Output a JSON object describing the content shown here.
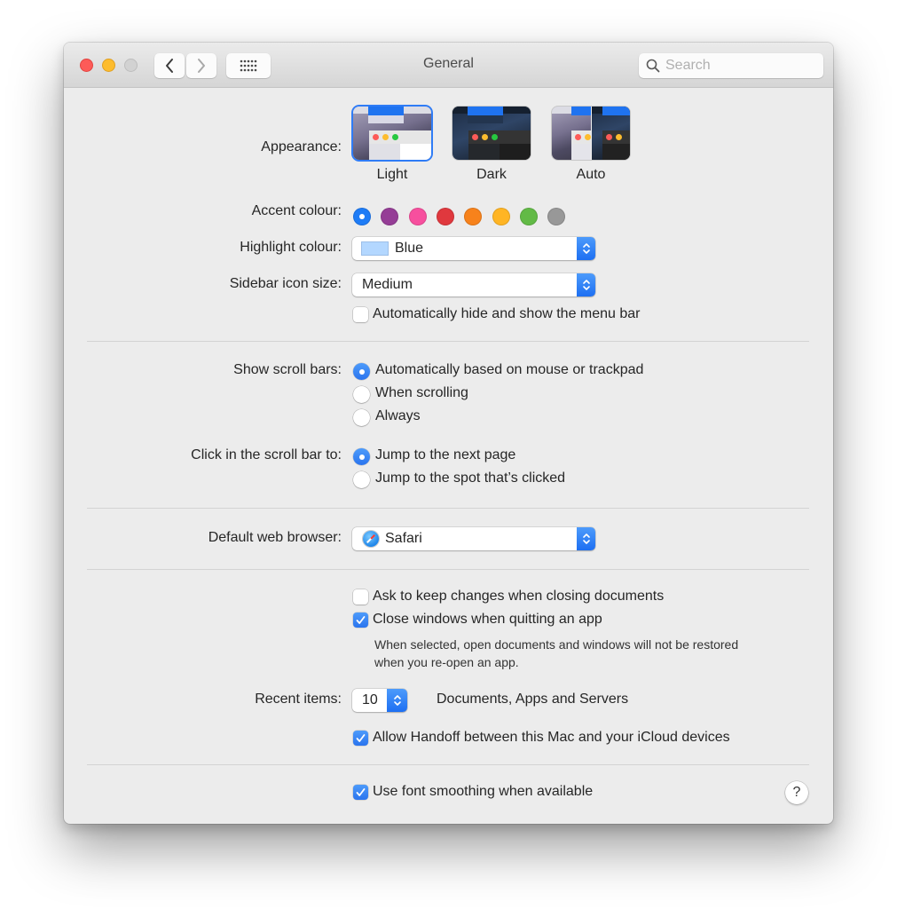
{
  "window": {
    "title": "General",
    "traffic_lights": [
      "close",
      "minimize",
      "zoom"
    ],
    "nav": {
      "back_icon": "chevron-left-icon",
      "forward_icon": "chevron-right-icon",
      "show_all_icon": "grid-icon"
    },
    "search": {
      "placeholder": "Search",
      "value": ""
    }
  },
  "appearance": {
    "label": "Appearance:",
    "options": [
      {
        "label": "Light",
        "selected": true
      },
      {
        "label": "Dark",
        "selected": false
      },
      {
        "label": "Auto",
        "selected": false
      }
    ]
  },
  "accent": {
    "label": "Accent colour:",
    "colors": [
      {
        "name": "blue",
        "hex": "#1e7cf6",
        "selected": true
      },
      {
        "name": "purple",
        "hex": "#953d96",
        "selected": false
      },
      {
        "name": "pink",
        "hex": "#f74f9e",
        "selected": false
      },
      {
        "name": "red",
        "hex": "#e0383e",
        "selected": false
      },
      {
        "name": "orange",
        "hex": "#f7821b",
        "selected": false
      },
      {
        "name": "yellow",
        "hex": "#ffb524",
        "selected": false
      },
      {
        "name": "green",
        "hex": "#62ba46",
        "selected": false
      },
      {
        "name": "graphite",
        "hex": "#989898",
        "selected": false
      }
    ]
  },
  "highlight": {
    "label": "Highlight colour:",
    "value": "Blue",
    "swatch": "#b3d7ff"
  },
  "sidebar_icon_size": {
    "label": "Sidebar icon size:",
    "value": "Medium"
  },
  "menu_bar": {
    "label": "Automatically hide and show the menu bar",
    "checked": false
  },
  "scroll_bars": {
    "label": "Show scroll bars:",
    "options": [
      {
        "label": "Automatically based on mouse or trackpad",
        "checked": true
      },
      {
        "label": "When scrolling",
        "checked": false
      },
      {
        "label": "Always",
        "checked": false
      }
    ]
  },
  "click_scroll": {
    "label": "Click in the scroll bar to:",
    "options": [
      {
        "label": "Jump to the next page",
        "checked": true
      },
      {
        "label": "Jump to the spot that’s clicked",
        "checked": false
      }
    ]
  },
  "browser": {
    "label": "Default web browser:",
    "value": "Safari"
  },
  "documents": {
    "ask_keep": {
      "label": "Ask to keep changes when closing documents",
      "checked": false
    },
    "close_windows": {
      "label": "Close windows when quitting an app",
      "checked": true
    },
    "help_line1": "When selected, open documents and windows will not be restored",
    "help_line2": "when you re-open an app."
  },
  "recent_items": {
    "label": "Recent items:",
    "value": "10",
    "suffix": "Documents, Apps and Servers"
  },
  "handoff": {
    "label": "Allow Handoff between this Mac and your iCloud devices",
    "checked": true
  },
  "font_smoothing": {
    "label": "Use font smoothing when available",
    "checked": true
  },
  "help_button": "?"
}
